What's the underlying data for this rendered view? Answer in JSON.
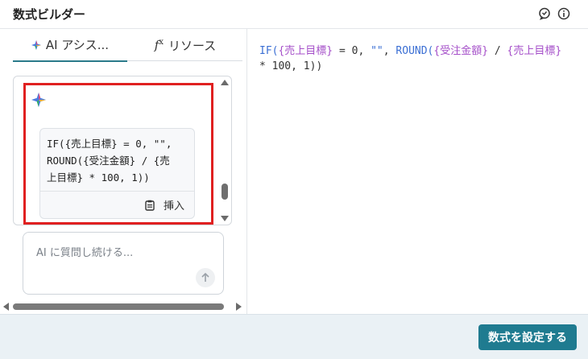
{
  "header": {
    "title": "数式ビルダー",
    "icons": [
      "feedback-icon",
      "info-icon"
    ]
  },
  "tabs": [
    {
      "label": "AI アシス...",
      "icon": "sparkle-icon",
      "active": true
    },
    {
      "label": "リソース",
      "icon": "fx-icon",
      "active": false
    }
  ],
  "fx_icon": {
    "main": "f",
    "sub": "x"
  },
  "chat": {
    "suggestion_code": "IF({売上目標} = 0, \"\",\nROUND({受注金額} / {売\n上目標} * 100, 1))",
    "insert_label": "挿入"
  },
  "input": {
    "placeholder": "AI に質問し続ける..."
  },
  "editor": {
    "p1": "IF(",
    "p2": "{売上目標}",
    "p3": " = 0, ",
    "p4": "\"\"",
    "p5": ", ",
    "p6": "ROUND(",
    "p7": "{受注金額}",
    "p8": " / ",
    "p9": "{売上目標}",
    "p10": " * 100, 1))"
  },
  "footer": {
    "submit_label": "数式を設定する"
  },
  "colors": {
    "accent": "#1f7b90",
    "tab_underline": "#2a7a8a",
    "highlight": "#e02020",
    "keyword": "#3b6fd4",
    "field": "#a54fc9"
  }
}
